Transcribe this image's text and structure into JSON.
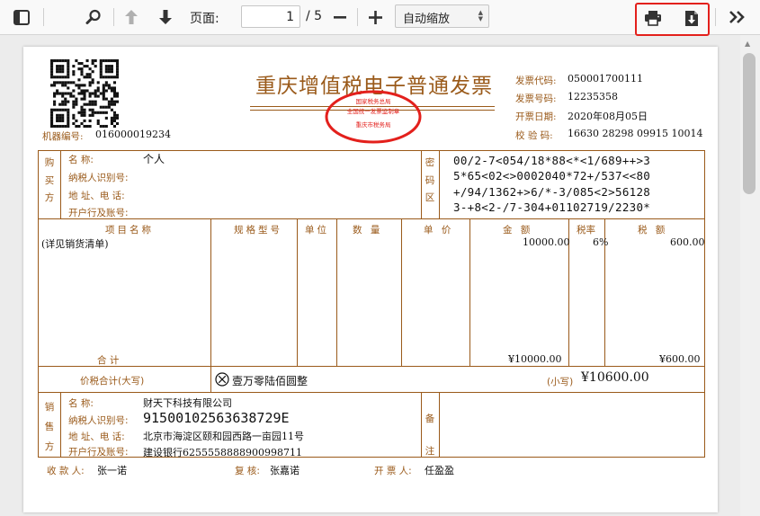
{
  "toolbar": {
    "page_label": "页面:",
    "page_current": "1",
    "page_total": "/ 5",
    "zoom_selected": "自动缩放"
  },
  "invoice": {
    "title": "重庆增值税电子普通发票",
    "seal": {
      "top_text": "国家税务总局",
      "middle_text": "全国统一发票监制章",
      "bottom_text": "重庆市税务局"
    },
    "machine_no_label": "机器编号:",
    "machine_no": "016000019234",
    "code_label": "发票代码:",
    "code": "050001700111",
    "number_label": "发票号码:",
    "number": "12235358",
    "date_label": "开票日期:",
    "date": "2020年08月05日",
    "check_label": "校 验 码:",
    "check_code": "16630 28298 09915 10014",
    "buyer": {
      "section_label": [
        "购",
        "买",
        "方"
      ],
      "name_label": "名          称:",
      "name": "个人",
      "tax_id_label": "纳税人识别号:",
      "address_label": "地  址、电  话:",
      "bank_label": "开户行及账号:"
    },
    "cipher": {
      "section_label": [
        "密",
        "码",
        "区"
      ],
      "lines": [
        "00/2-7<054/18*88<*<1/689++>3",
        "5*65<02<>0002040*72+/537<<80",
        "+/94/1362+>6/*-3/085<2>56128",
        "3-+8<2-/7-304+01102719/2230*"
      ]
    },
    "items_header": {
      "name": "项目名称",
      "spec": "规格型号",
      "unit": "单位",
      "qty": "数  量",
      "price": "单  价",
      "amount": "金  额",
      "rate": "税率",
      "tax": "税  额"
    },
    "items": [
      {
        "name": "(详见销货清单)",
        "amount": "10000.00",
        "rate": "6%",
        "tax": "600.00"
      }
    ],
    "total_label": "合      计",
    "total_amount": "¥10000.00",
    "total_tax": "¥600.00",
    "grand_label": "价税合计(大写)",
    "grand_words": "壹万零陆佰圆整",
    "small_label": "(小写)",
    "grand_small": "¥10600.00",
    "seller": {
      "section_label": [
        "销",
        "售",
        "方"
      ],
      "name_label": "名          称:",
      "name": "财天下科技有限公司",
      "tax_id_label": "纳税人识别号:",
      "tax_id": "91500102563638729E",
      "address_label": "地  址、电  话:",
      "address": "北京市海淀区颐和园西路一亩园11号",
      "bank_label": "开户行及账号:",
      "bank": "建设银行6255558888900998711"
    },
    "remark_label": [
      "备",
      "注"
    ],
    "payee_label": "收 款 人:",
    "payee": "张一诺",
    "reviewer_label": "复  核:",
    "reviewer": "张嘉诺",
    "issuer_label": "开 票 人:",
    "issuer": "任盈盈"
  },
  "colors": {
    "print_brown": "#9a5a1a",
    "seal_red": "#e3201c",
    "highlight_red": "#e3201c"
  },
  "icons": [
    "sidebar-toggle-icon",
    "search-icon",
    "arrow-up-icon",
    "arrow-down-icon",
    "minus-icon",
    "plus-icon",
    "print-icon",
    "download-icon",
    "double-chevron-right-icon",
    "qr-code-icon",
    "x-circle-icon"
  ]
}
